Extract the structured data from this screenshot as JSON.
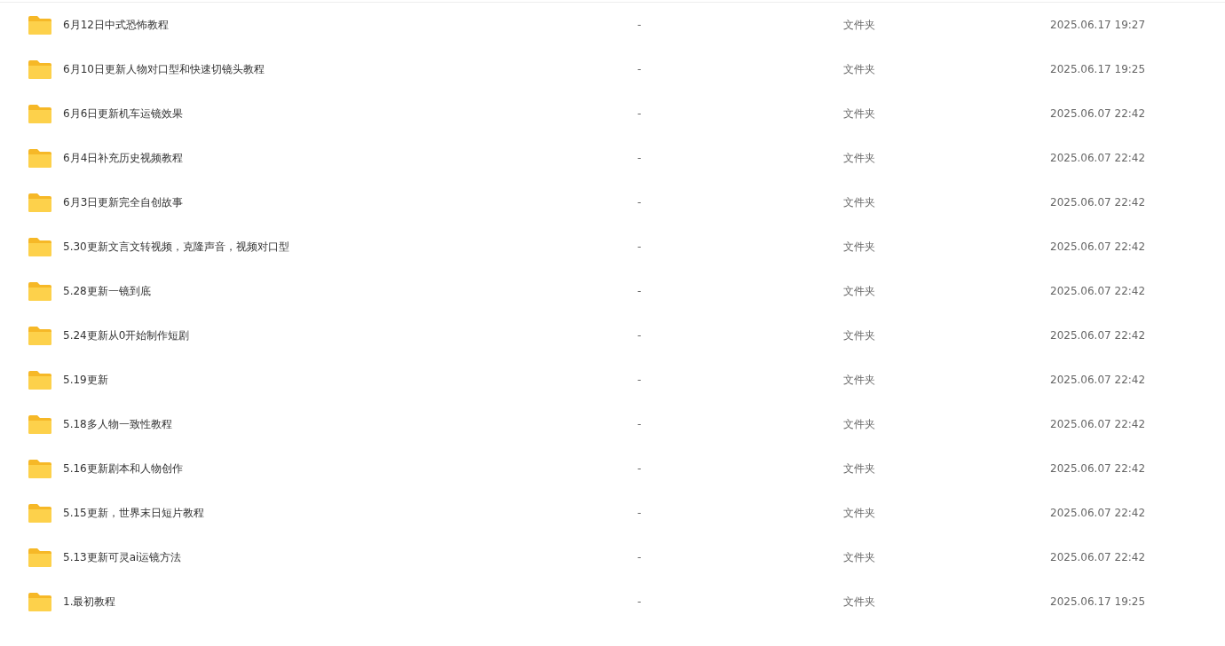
{
  "files": [
    {
      "name": "6月12日中式恐怖教程",
      "size": "-",
      "type": "文件夹",
      "modified": "2025.06.17 19:27"
    },
    {
      "name": "6月10日更新人物对口型和快速切镜头教程",
      "size": "-",
      "type": "文件夹",
      "modified": "2025.06.17 19:25"
    },
    {
      "name": "6月6日更新机车运镜效果",
      "size": "-",
      "type": "文件夹",
      "modified": "2025.06.07 22:42"
    },
    {
      "name": "6月4日补充历史视频教程",
      "size": "-",
      "type": "文件夹",
      "modified": "2025.06.07 22:42"
    },
    {
      "name": "6月3日更新完全自创故事",
      "size": "-",
      "type": "文件夹",
      "modified": "2025.06.07 22:42"
    },
    {
      "name": "5.30更新文言文转视频，克隆声音，视频对口型",
      "size": "-",
      "type": "文件夹",
      "modified": "2025.06.07 22:42"
    },
    {
      "name": "5.28更新一镜到底",
      "size": "-",
      "type": "文件夹",
      "modified": "2025.06.07 22:42"
    },
    {
      "name": "5.24更新从0开始制作短剧",
      "size": "-",
      "type": "文件夹",
      "modified": "2025.06.07 22:42"
    },
    {
      "name": "5.19更新",
      "size": "-",
      "type": "文件夹",
      "modified": "2025.06.07 22:42"
    },
    {
      "name": "5.18多人物一致性教程",
      "size": "-",
      "type": "文件夹",
      "modified": "2025.06.07 22:42"
    },
    {
      "name": "5.16更新剧本和人物创作",
      "size": "-",
      "type": "文件夹",
      "modified": "2025.06.07 22:42"
    },
    {
      "name": "5.15更新，世界末日短片教程",
      "size": "-",
      "type": "文件夹",
      "modified": "2025.06.07 22:42"
    },
    {
      "name": "5.13更新可灵ai运镜方法",
      "size": "-",
      "type": "文件夹",
      "modified": "2025.06.07 22:42"
    },
    {
      "name": "1.最初教程",
      "size": "-",
      "type": "文件夹",
      "modified": "2025.06.17 19:25"
    }
  ]
}
